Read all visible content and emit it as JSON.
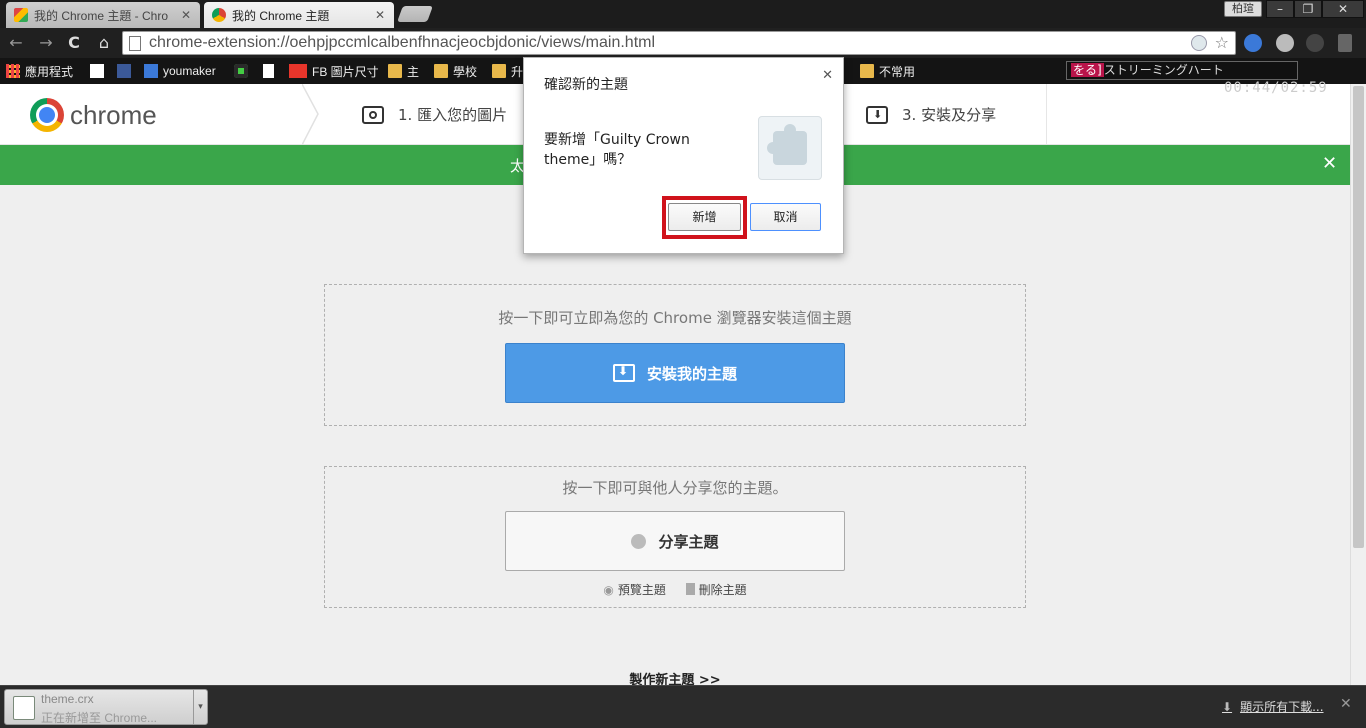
{
  "window": {
    "tabs": [
      {
        "title": "我的 Chrome 主題 - Chro",
        "close": "✕"
      },
      {
        "title": "我的 Chrome 主題",
        "close": "✕"
      }
    ],
    "profile_label": "柏瑄",
    "controls": {
      "minimize": "–",
      "maximize": "❐",
      "close": "✕"
    }
  },
  "toolbar": {
    "url": "chrome-extension://oehpjpccmlcalbenfhnacjeocbjdonic/views/main.html",
    "back": "←",
    "forward": "→",
    "reload": "C",
    "home": "⌂",
    "star": "☆"
  },
  "bookmarks": [
    {
      "label": "應用程式",
      "icon": "apps-grid-icon"
    },
    {
      "label": "",
      "icon": "p-icon"
    },
    {
      "label": "",
      "icon": "facebook-icon"
    },
    {
      "label": "youmaker",
      "icon": "g-icon"
    },
    {
      "label": "",
      "icon": "green-dot-icon"
    },
    {
      "label": "",
      "icon": "page-icon"
    },
    {
      "label": "FB 圖片尺寸",
      "icon": "tc-icon"
    },
    {
      "label": "主",
      "icon": "folder-icon"
    },
    {
      "label": "學校",
      "icon": "folder-icon"
    },
    {
      "label": "升",
      "icon": "folder-icon"
    },
    {
      "label": "不常用",
      "icon": "folder-icon"
    }
  ],
  "stream": {
    "highlight": "をる]",
    "text": "ストリーミングハート",
    "time": "00:44/02:59"
  },
  "page": {
    "logo_text": "chrome",
    "steps": [
      {
        "label": "1. 匯入您的圖片"
      },
      {
        "label": "3. 安裝及分享"
      }
    ],
    "greenbar_text": "太",
    "greenbar_close": "✕",
    "install_hint": "按一下即可立即為您的 Chrome 瀏覽器安裝這個主題",
    "install_button": "安裝我的主題",
    "share_hint": "按一下即可與他人分享您的主題。",
    "share_button": "分享主題",
    "preview_link": "預覽主題",
    "delete_link": "刪除主題",
    "make_new": "製作新主題 >>"
  },
  "dialog": {
    "title": "確認新的主題",
    "close": "✕",
    "message": "要新增「Guilty Crown theme」嗎？",
    "add_button": "新增",
    "cancel_button": "取消",
    "highlight_color": "#d0121b"
  },
  "download_shelf": {
    "file_name": "theme.crx",
    "status": "正在新增至 Chrome...",
    "show_all": "顯示所有下載...",
    "close": "✕"
  },
  "colors": {
    "green_bar": "#3aa64a",
    "install_button": "#4d9ae6"
  }
}
